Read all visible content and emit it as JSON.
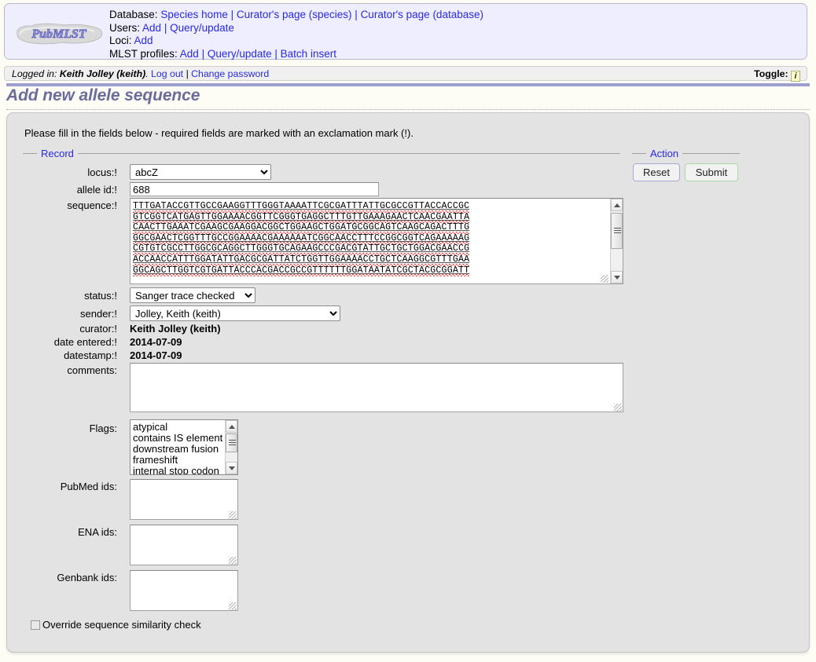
{
  "header": {
    "logo_text": "PubMLST",
    "nav": [
      {
        "label": "Database:",
        "links": [
          {
            "text": "Species home"
          },
          {
            "text": "Curator's page (species)"
          },
          {
            "text": "Curator's page (database)"
          }
        ]
      },
      {
        "label": "Users:",
        "links": [
          {
            "text": "Add"
          },
          {
            "text": "Query/update"
          }
        ]
      },
      {
        "label": "Loci:",
        "links": [
          {
            "text": "Add"
          }
        ]
      },
      {
        "label": "MLST profiles:",
        "links": [
          {
            "text": "Add"
          },
          {
            "text": "Query/update"
          },
          {
            "text": "Batch insert"
          }
        ]
      }
    ]
  },
  "loginbar": {
    "prefix": "Logged in:",
    "user": "Keith Jolley (keith)",
    "suffix": ".",
    "logout": "Log out",
    "separator": "|",
    "change_password": "Change password",
    "toggle_label": "Toggle:",
    "toggle_icon": "i"
  },
  "page_title": "Add new allele sequence",
  "intro": "Please fill in the fields below - required fields are marked with an exclamation mark (!).",
  "fieldsets": {
    "record_legend": "Record",
    "action_legend": "Action"
  },
  "form": {
    "locus": {
      "label": "locus:!",
      "value": "abcZ"
    },
    "allele_id": {
      "label": "allele id:!",
      "value": "688"
    },
    "sequence": {
      "label": "sequence:!",
      "lines": [
        "TTTGATACCGTTGCCGAAGGTTTGGGTAAAATTCGCGATTTATTGCGCCGTTACCACCGC",
        "GTCGGTCATGAGTTGGAAAACGGTTCGGGTGAGGCTTTGTTGAAAGAACTCAACGAATTA",
        "CAACTTGAAATCGAAGCGAAGGACGGCTGGAAGCTGGATGCGGCAGTCAAGCAGACTTTG",
        "GGCGAACTCGGTTTGCCGGAAAACGAAAAAATCGGCAACCTTTCCGGCGGTCAGAAAAAG",
        "CGTGTCGCCTTGGCGCAGGCTTGGGTGCAGAAGCCCGACGTATTGCTGCTGGACGAACCG",
        "ACCAACCATTTGGATATTGACGCGATTATCTGGTTGGAAAACCTGCTCAAGGCGTTTGAA",
        "GGCAGCTTGGTCGTGATTACCCACGACCGCCGTTTTTTGGATAATATCGCTACGCGGATT"
      ]
    },
    "status": {
      "label": "status:!",
      "value": "Sanger trace checked"
    },
    "sender": {
      "label": "sender:!",
      "value": "Jolley, Keith (keith)"
    },
    "curator": {
      "label": "curator:!",
      "value": "Keith Jolley (keith)"
    },
    "date_entered": {
      "label": "date entered:!",
      "value": "2014-07-09"
    },
    "datestamp": {
      "label": "datestamp:!",
      "value": "2014-07-09"
    },
    "comments": {
      "label": "comments:",
      "value": ""
    },
    "flags": {
      "label": "Flags:",
      "options": [
        "atypical",
        "contains IS element",
        "downstream fusion",
        "frameshift",
        "internal stop codon"
      ]
    },
    "pubmed_ids": {
      "label": "PubMed ids:",
      "value": ""
    },
    "ena_ids": {
      "label": "ENA ids:",
      "value": ""
    },
    "genbank_ids": {
      "label": "Genbank ids:",
      "value": ""
    },
    "override": {
      "label": "Override sequence similarity check",
      "checked": false
    }
  },
  "actions": {
    "reset_label": "Reset",
    "submit_label": "Submit"
  },
  "colors": {
    "link": "#2a2ae0",
    "title": "#6b6b9e",
    "header_bg": "#eeeeff",
    "panel_bg": "#e3e3e3",
    "rule": "#9f9fcf",
    "reset_border": "#a9a9d8",
    "submit_border": "#a9d8a9"
  }
}
